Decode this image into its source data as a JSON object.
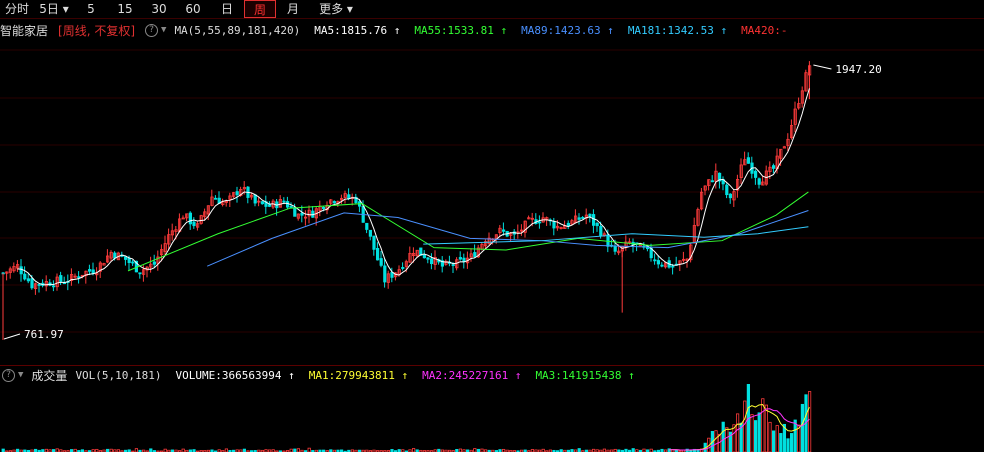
{
  "tabs": [
    {
      "label": "分时",
      "active": false
    },
    {
      "label": "5日",
      "active": false,
      "dropdown": true
    },
    {
      "label": "5",
      "active": false
    },
    {
      "label": "15",
      "active": false
    },
    {
      "label": "30",
      "active": false
    },
    {
      "label": "60",
      "active": false
    },
    {
      "label": "日",
      "active": false
    },
    {
      "label": "周",
      "active": true
    },
    {
      "label": "月",
      "active": false
    },
    {
      "label": "更多",
      "active": false,
      "dropdown": true
    }
  ],
  "price_panel": {
    "stock_name": "智能家居",
    "period_label": "[周线, 不复权]",
    "ma_label": "MA(5,55,89,181,420)",
    "ma_items": [
      {
        "text": "MA5:1815.76",
        "arrow": "↑",
        "color": "#ffffff"
      },
      {
        "text": "MA55:1533.81",
        "arrow": "↑",
        "color": "#33ff33"
      },
      {
        "text": "MA89:1423.63",
        "arrow": "↑",
        "color": "#4a90ff"
      },
      {
        "text": "MA181:1342.53",
        "arrow": "↑",
        "color": "#33ccff"
      },
      {
        "text": "MA420:-",
        "arrow": "",
        "color": "#ff3333"
      }
    ],
    "high_label": "1947.20",
    "low_label": "761.97"
  },
  "volume_panel": {
    "title": "成交量",
    "vol_label": "VOL(5,10,181)",
    "items": [
      {
        "text": "VOLUME:366563994",
        "arrow": "↑",
        "color": "#ffffff"
      },
      {
        "text": "MA1:279943811",
        "arrow": "↑",
        "color": "#ffff33"
      },
      {
        "text": "MA2:245227161",
        "arrow": "↑",
        "color": "#ff33ff"
      },
      {
        "text": "MA3:141915438",
        "arrow": "↑",
        "color": "#33ff33"
      }
    ]
  },
  "colors": {
    "up": "#ff3b3b",
    "down": "#00e0e0",
    "bg": "#000000",
    "grid": "#3a0000"
  },
  "chart_data": {
    "type": "candlestick",
    "ylim": [
      761.97,
      1947.2
    ],
    "high": 1947.2,
    "low": 761.97,
    "close_path": [
      {
        "i": 0,
        "y": 1050
      },
      {
        "i": 4,
        "y": 1080
      },
      {
        "i": 8,
        "y": 1000
      },
      {
        "i": 12,
        "y": 1010
      },
      {
        "i": 18,
        "y": 1020
      },
      {
        "i": 22,
        "y": 1050
      },
      {
        "i": 26,
        "y": 1070
      },
      {
        "i": 30,
        "y": 1140
      },
      {
        "i": 34,
        "y": 1110
      },
      {
        "i": 38,
        "y": 1060
      },
      {
        "i": 42,
        "y": 1090
      },
      {
        "i": 46,
        "y": 1210
      },
      {
        "i": 50,
        "y": 1300
      },
      {
        "i": 54,
        "y": 1250
      },
      {
        "i": 58,
        "y": 1380
      },
      {
        "i": 62,
        "y": 1350
      },
      {
        "i": 66,
        "y": 1420
      },
      {
        "i": 70,
        "y": 1350
      },
      {
        "i": 74,
        "y": 1340
      },
      {
        "i": 78,
        "y": 1360
      },
      {
        "i": 82,
        "y": 1300
      },
      {
        "i": 86,
        "y": 1310
      },
      {
        "i": 90,
        "y": 1360
      },
      {
        "i": 94,
        "y": 1380
      },
      {
        "i": 98,
        "y": 1370
      },
      {
        "i": 102,
        "y": 1200
      },
      {
        "i": 106,
        "y": 1020
      },
      {
        "i": 110,
        "y": 1070
      },
      {
        "i": 114,
        "y": 1150
      },
      {
        "i": 118,
        "y": 1120
      },
      {
        "i": 122,
        "y": 1080
      },
      {
        "i": 126,
        "y": 1090
      },
      {
        "i": 130,
        "y": 1120
      },
      {
        "i": 134,
        "y": 1200
      },
      {
        "i": 138,
        "y": 1230
      },
      {
        "i": 142,
        "y": 1210
      },
      {
        "i": 146,
        "y": 1270
      },
      {
        "i": 150,
        "y": 1290
      },
      {
        "i": 154,
        "y": 1250
      },
      {
        "i": 158,
        "y": 1270
      },
      {
        "i": 162,
        "y": 1300
      },
      {
        "i": 166,
        "y": 1230
      },
      {
        "i": 170,
        "y": 1130
      },
      {
        "i": 174,
        "y": 1180
      },
      {
        "i": 178,
        "y": 1150
      },
      {
        "i": 182,
        "y": 1100
      },
      {
        "i": 186,
        "y": 1080
      },
      {
        "i": 190,
        "y": 1110
      },
      {
        "i": 194,
        "y": 1400
      },
      {
        "i": 198,
        "y": 1480
      },
      {
        "i": 202,
        "y": 1360
      },
      {
        "i": 206,
        "y": 1550
      },
      {
        "i": 210,
        "y": 1450
      },
      {
        "i": 214,
        "y": 1500
      },
      {
        "i": 218,
        "y": 1640
      },
      {
        "i": 222,
        "y": 1850
      },
      {
        "i": 224,
        "y": 1947
      }
    ],
    "ma_series": [
      {
        "name": "MA55",
        "color": "#33ff33",
        "points": [
          [
            35,
            1060
          ],
          [
            60,
            1220
          ],
          [
            80,
            1330
          ],
          [
            100,
            1350
          ],
          [
            120,
            1160
          ],
          [
            140,
            1150
          ],
          [
            160,
            1200
          ],
          [
            180,
            1170
          ],
          [
            200,
            1190
          ],
          [
            215,
            1300
          ],
          [
            224,
            1400
          ]
        ]
      },
      {
        "name": "MA89",
        "color": "#4a90ff",
        "points": [
          [
            57,
            1080
          ],
          [
            75,
            1200
          ],
          [
            95,
            1310
          ],
          [
            110,
            1290
          ],
          [
            130,
            1200
          ],
          [
            150,
            1190
          ],
          [
            165,
            1170
          ],
          [
            185,
            1160
          ],
          [
            205,
            1220
          ],
          [
            224,
            1320
          ]
        ]
      },
      {
        "name": "MA181",
        "color": "#33ccff",
        "points": [
          [
            117,
            1175
          ],
          [
            150,
            1190
          ],
          [
            175,
            1220
          ],
          [
            195,
            1205
          ],
          [
            210,
            1220
          ],
          [
            224,
            1250
          ]
        ]
      }
    ],
    "volume": {
      "ylim": [
        0,
        400000000
      ],
      "bars_end": [
        {
          "i": 195,
          "v": 80000000
        },
        {
          "i": 200,
          "v": 150000000
        },
        {
          "i": 205,
          "v": 220000000
        },
        {
          "i": 207,
          "v": 366563994
        },
        {
          "i": 210,
          "v": 280000000
        },
        {
          "i": 214,
          "v": 200000000
        },
        {
          "i": 218,
          "v": 120000000
        },
        {
          "i": 222,
          "v": 250000000
        },
        {
          "i": 224,
          "v": 366563994
        }
      ]
    }
  }
}
